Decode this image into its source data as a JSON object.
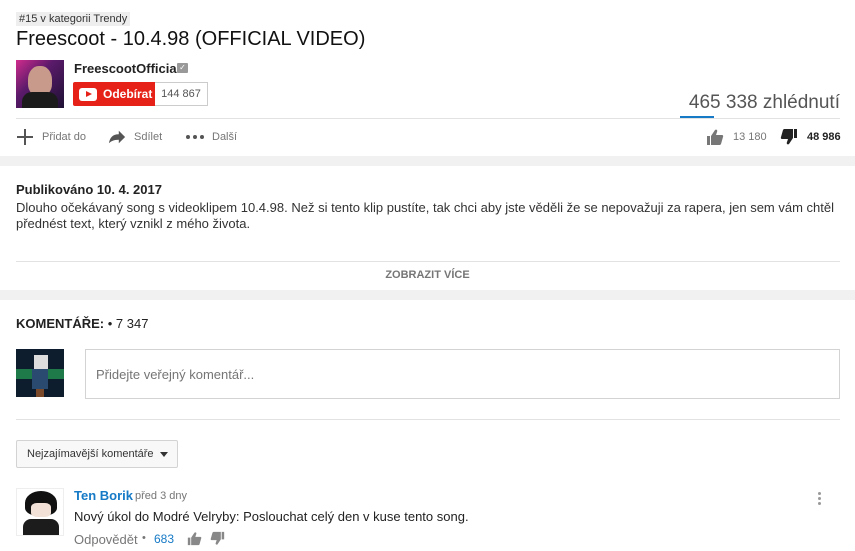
{
  "video": {
    "trend_badge": "#15 v kategorii Trendy",
    "title": "Freescoot - 10.4.98 (OFFICIAL VIDEO)",
    "channel_name": "FreescootOfficial",
    "subscribe_label": "Odebírat",
    "subscriber_count": "144 867",
    "view_count": "465 338 zhlédnutí",
    "actions": {
      "add_label": "Přidat do",
      "share_label": "Sdílet",
      "more_label": "Další"
    },
    "likes": "13 180",
    "dislikes": "48 986",
    "like_ratio": 0.21
  },
  "description": {
    "published": "Publikováno 10. 4. 2017",
    "text": "Dlouho očekávaný song s videoklipem 10.4.98. Než si tento klip pustíte, tak chci aby jste věděli že se nepovažuji za rapera, jen sem vám chtěl přednést text, který vznikl z mého života.",
    "show_more_label": "ZOBRAZIT VÍCE"
  },
  "comments": {
    "header_label": "KOMENTÁŘE:",
    "count": "• 7 347",
    "input_placeholder": "Přidejte veřejný komentář...",
    "sort_label": "Nejzajímavější komentáře",
    "items": [
      {
        "author": "Ten Borik",
        "time": "před 3 dny",
        "text": "Nový úkol do Modré Velryby: Poslouchat celý den v kuse tento song.",
        "reply_label": "Odpovědět",
        "separator": "•",
        "likes": "683"
      }
    ]
  },
  "colors": {
    "brand_red": "#e62117",
    "link_blue": "#167ac6"
  }
}
